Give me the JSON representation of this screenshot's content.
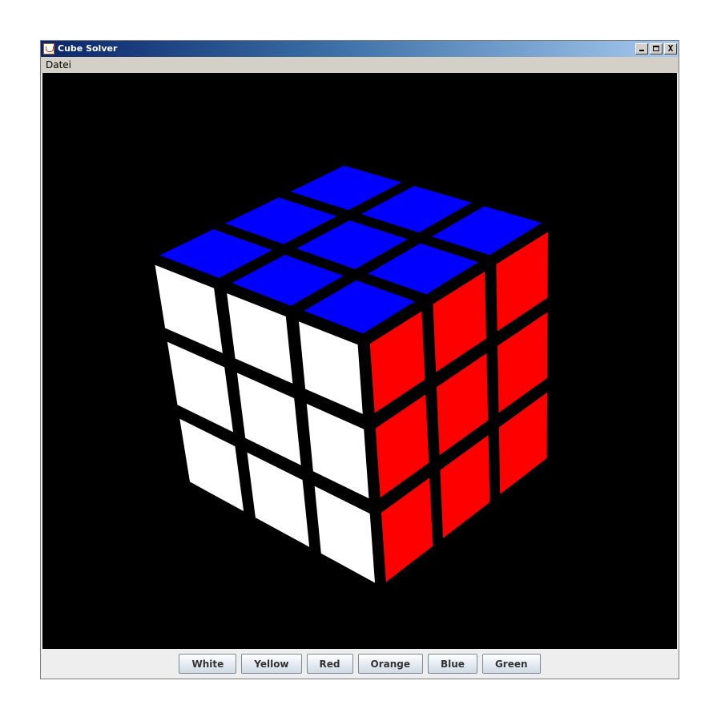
{
  "window": {
    "title": "Cube Solver",
    "controls": {
      "minimize": "_",
      "maximize": "□",
      "close": "X"
    }
  },
  "menu": {
    "items": [
      {
        "label": "Datei"
      }
    ]
  },
  "cube": {
    "faces": {
      "top": {
        "color": "#0000ff",
        "stickers": [
          "blue",
          "blue",
          "blue",
          "blue",
          "blue",
          "blue",
          "blue",
          "blue",
          "blue"
        ]
      },
      "front": {
        "color": "#ffffff",
        "stickers": [
          "white",
          "white",
          "white",
          "white",
          "white",
          "white",
          "white",
          "white",
          "white"
        ]
      },
      "right": {
        "color": "#ff0000",
        "stickers": [
          "red",
          "red",
          "red",
          "red",
          "red",
          "red",
          "red",
          "red",
          "red"
        ]
      }
    },
    "sticker_colors": {
      "blue": "#0000ff",
      "white": "#ffffff",
      "red": "#ff0000"
    },
    "background": "#000000"
  },
  "buttons": [
    {
      "label": "White"
    },
    {
      "label": "Yellow"
    },
    {
      "label": "Red"
    },
    {
      "label": "Orange"
    },
    {
      "label": "Blue"
    },
    {
      "label": "Green"
    }
  ]
}
